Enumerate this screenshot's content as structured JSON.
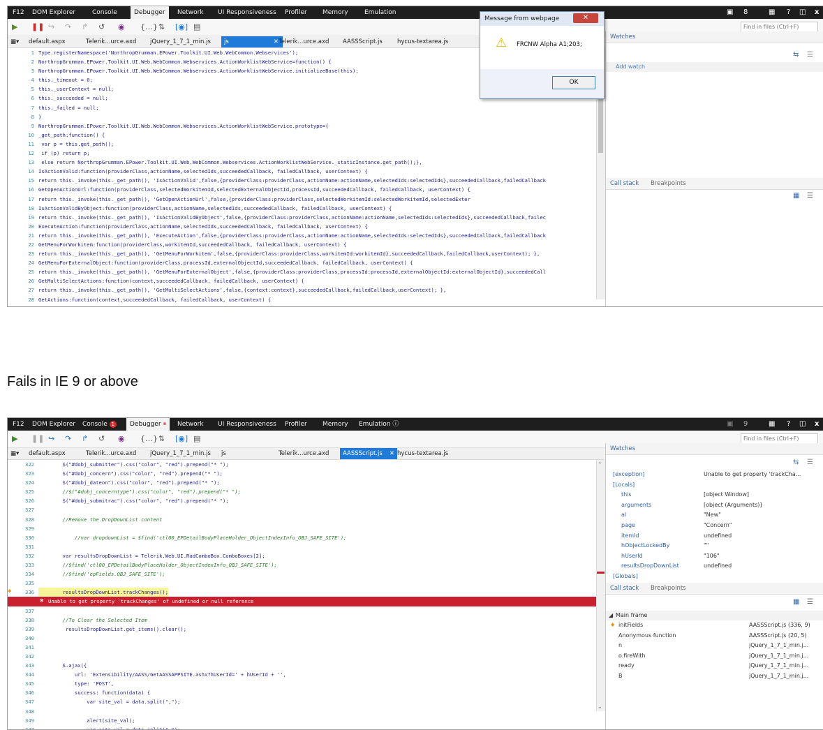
{
  "top_devtools": {
    "tabs": [
      "F12",
      "DOM Explorer",
      "Console",
      "Debugger",
      "Network",
      "UI Responsiveness",
      "Profiler",
      "Memory",
      "Emulation"
    ],
    "active_tab": "Debugger",
    "right_controls": {
      "counter": "8",
      "help": "?",
      "close": "x"
    },
    "find_placeholder": "Find in files (Ctrl+F)",
    "file_tabs": [
      "default.aspx",
      "Telerik...urce.axd",
      "jQuery_1_7_1_min.js",
      "js",
      "Telerik...urce.axd",
      "AASSScript.js",
      "hycus-textarea.js"
    ],
    "active_file": "js",
    "code_lines": [
      {
        "n": "1",
        "t": "Type.registerNamespace('NorthropGrumman.EPower.Toolkit.UI.Web.WebCommon.Webservices');"
      },
      {
        "n": "2",
        "t": "NorthropGrumman.EPower.Toolkit.UI.Web.WebCommon.Webservices.ActionWorklistWebService=function() {"
      },
      {
        "n": "3",
        "t": "NorthropGrumman.EPower.Toolkit.UI.Web.WebCommon.Webservices.ActionWorklistWebService.initializeBase(this);"
      },
      {
        "n": "4",
        "t": "this._timeout = 0;"
      },
      {
        "n": "5",
        "t": "this._userContext = null;"
      },
      {
        "n": "6",
        "t": "this._succeeded = null;"
      },
      {
        "n": "7",
        "t": "this._failed = null;"
      },
      {
        "n": "8",
        "t": "}"
      },
      {
        "n": "9",
        "t": "NorthropGrumman.EPower.Toolkit.UI.Web.WebCommon.Webservices.ActionWorklistWebService.prototype={"
      },
      {
        "n": "10",
        "t": "_get_path:function() {"
      },
      {
        "n": "11",
        "t": " var p = this.get_path();"
      },
      {
        "n": "12",
        "t": " if (p) return p;"
      },
      {
        "n": "13",
        "t": " else return NorthropGrumman.EPower.Toolkit.UI.Web.WebCommon.Webservices.ActionWorklistWebService._staticInstance.get_path();},"
      },
      {
        "n": "14",
        "t": "IsActionValid:function(providerClass,actionName,selectedIds,succeededCallback, failedCallback, userContext) {"
      },
      {
        "n": "15",
        "t": "return this._invoke(this._get_path(), 'IsActionValid',false,{providerClass:providerClass,actionName:actionName,selectedIds:selectedIds},succeededCallback,failedCallback"
      },
      {
        "n": "16",
        "t": "GetOpenActionUrl:function(providerClass,selectedWorkitemId,selectedExternalObjectId,processId,succeededCallback, failedCallback, userContext) {"
      },
      {
        "n": "17",
        "t": "return this._invoke(this._get_path(), 'GetOpenActionUrl',false,{providerClass:providerClass,selectedWorkitemId:selectedWorkitemId,selectedExter"
      },
      {
        "n": "18",
        "t": "IsActionValidByObject:function(providerClass,actionName,selectedIds,succeededCallback, failedCallback, userContext) {"
      },
      {
        "n": "19",
        "t": "return this._invoke(this._get_path(), 'IsActionValidByObject',false,{providerClass:providerClass,actionName:actionName,selectedIds:selectedIds},succeededCallback,failec"
      },
      {
        "n": "20",
        "t": "ExecuteAction:function(providerClass,actionName,selectedIds,succeededCallback, failedCallback, userContext) {"
      },
      {
        "n": "21",
        "t": "return this._invoke(this._get_path(), 'ExecuteAction',false,{providerClass:providerClass,actionName:actionName,selectedIds:selectedIds},succeededCallback,failedCallback"
      },
      {
        "n": "22",
        "t": "GetMenuForWorkitem:function(providerClass,workitemId,succeededCallback, failedCallback, userContext) {"
      },
      {
        "n": "23",
        "t": "return this._invoke(this._get_path(), 'GetMenuForWorkitem',false,{providerClass:providerClass,workitemId:workitemId},succeededCallback,failedCallback,userContext); },"
      },
      {
        "n": "24",
        "t": "GetMenuForExternalObject:function(providerClass,processId,externalObjectId,succeededCallback, failedCallback, userContext) {"
      },
      {
        "n": "25",
        "t": "return this._invoke(this._get_path(), 'GetMenuForExternalObject',false,{providerClass:providerClass,processId:processId,externalObjectId:externalObjectId},succeededCall"
      },
      {
        "n": "26",
        "t": "GetMultiSelectActions:function(context,succeededCallback, failedCallback, userContext) {"
      },
      {
        "n": "27",
        "t": "return this._invoke(this._get_path(), 'GetMultiSelectActions',false,{context:context},succeededCallback,failedCallback,userContext); },"
      },
      {
        "n": "28",
        "t": "GetActions:function(context,succeededCallback, failedCallback, userContext) {"
      }
    ],
    "right_panel": {
      "watches": "Watches",
      "add_watch": "Add watch",
      "call_stack": "Call stack",
      "breakpoints": "Breakpoints"
    },
    "dialog": {
      "title": "Message from webpage",
      "message": "FRCNW Alpha  A1;203;",
      "ok": "OK"
    }
  },
  "caption": "Fails in IE 9 or above",
  "bottom_devtools": {
    "tabs": [
      "F12",
      "DOM Explorer",
      "Console",
      "Debugger",
      "Network",
      "UI Responsiveness",
      "Profiler",
      "Memory",
      "Emulation"
    ],
    "active_tab": "Debugger",
    "console_badge": "1",
    "right_controls": {
      "counter": "9",
      "help": "?",
      "close": "x"
    },
    "find_placeholder": "Find in files (Ctrl+F)",
    "file_tabs": [
      "default.aspx",
      "Telerik...urce.axd",
      "jQuery_1_7_1_min.js",
      "js",
      "Telerik...urce.axd",
      "AASSScript.js",
      "hycus-textarea.js"
    ],
    "active_file": "AASSScript.js",
    "code_lines": [
      {
        "n": "322",
        "t": "        $(\"#dobj_submitter\").css(\"color\", \"red\").prepend(\"* \");"
      },
      {
        "n": "323",
        "t": "        $(\"#dobj_concern\").css(\"color\", \"red\").prepend(\"* \");"
      },
      {
        "n": "324",
        "t": "        $(\"#dobj_dateon\").css(\"color\", \"red\").prepend(\"* \");"
      },
      {
        "n": "325",
        "t": "        //$(\"#dobj_concerntype\").css(\"color\", \"red\").prepend(\"* \");"
      },
      {
        "n": "326",
        "t": "        $(\"#dobj_submitrac\").css(\"color\", \"red\").prepend(\"* \");"
      },
      {
        "n": "327",
        "t": ""
      },
      {
        "n": "328",
        "t": "        //Remove the DropDownList content"
      },
      {
        "n": "329",
        "t": ""
      },
      {
        "n": "330",
        "t": "            //var dropdownList = $find('ctl00_EPDetailBodyPlaceHolder_ObjectIndexInfo_OBJ_SAFE_SITE');"
      },
      {
        "n": "331",
        "t": ""
      },
      {
        "n": "332",
        "t": "        var resultsDropDownList = Telerik.Web.UI.RadComboBox.ComboBoxes[2];"
      },
      {
        "n": "333",
        "t": "        //$find('ctl00_EPDetailBodyPlaceHolder_ObjectIndexInfo_OBJ_SAFE_SITE');"
      },
      {
        "n": "334",
        "t": "        //$find('epFields.OBJ_SAFE_SITE');"
      },
      {
        "n": "335",
        "t": ""
      },
      {
        "n": "336",
        "t": "        resultsDropDownList.trackChanges();"
      },
      {
        "n": "",
        "t": "Unable to get property 'trackChanges' of undefined or null reference"
      },
      {
        "n": "337",
        "t": ""
      },
      {
        "n": "338",
        "t": "        //To Clear the Selected Item"
      },
      {
        "n": "339",
        "t": "         resultsDropDownList.get_items().clear();"
      },
      {
        "n": "340",
        "t": ""
      },
      {
        "n": "341",
        "t": ""
      },
      {
        "n": "342",
        "t": ""
      },
      {
        "n": "343",
        "t": "        $.ajax({"
      },
      {
        "n": "344",
        "t": "            url: 'Extensibility/AASS/GetAASSAPPSITE.ashx?hUserId=' + hUserId + '',"
      },
      {
        "n": "345",
        "t": "            type: 'POST',"
      },
      {
        "n": "346",
        "t": "            success: function(data) {"
      },
      {
        "n": "347",
        "t": "                var site_val = data.split(\",\");"
      },
      {
        "n": "348",
        "t": ""
      },
      {
        "n": "349",
        "t": "                alert(site_val);"
      },
      {
        "n": "347",
        "t": "                var site_val = data.split(\",\");"
      }
    ],
    "highlight_line_index": 14,
    "error_line_index": 15,
    "watches_title": "Watches",
    "watches": [
      {
        "name": "[exception]",
        "value": "Unable to get property 'trackCha..."
      },
      {
        "name": "[Locals]",
        "value": ""
      },
      {
        "name": "this",
        "value": "[object Window]"
      },
      {
        "name": "arguments",
        "value": "[object (Arguments)]"
      },
      {
        "name": "al",
        "value": "\"New\""
      },
      {
        "name": "page",
        "value": "\"Concern\""
      },
      {
        "name": "itemId",
        "value": "undefined"
      },
      {
        "name": "hObjectLockedBy",
        "value": "\"\""
      },
      {
        "name": "hUserId",
        "value": "\"106\""
      },
      {
        "name": "resultsDropDownList",
        "value": "undefined"
      },
      {
        "name": "[Globals]",
        "value": ""
      }
    ],
    "call_stack_title": "Call stack",
    "breakpoints_title": "Breakpoints",
    "main_frame": "Main frame",
    "call_stack": [
      {
        "name": "initFields",
        "value": "AASSScript.js (336, 9)"
      },
      {
        "name": "Anonymous function",
        "value": "AASSScript.js (20, 5)"
      },
      {
        "name": "n",
        "value": "jQuery_1_7_1_min.j..."
      },
      {
        "name": "o.fireWith",
        "value": "jQuery_1_7_1_min.j..."
      },
      {
        "name": "ready",
        "value": "jQuery_1_7_1_min.j..."
      },
      {
        "name": "B",
        "value": "jQuery_1_7_1_min.j..."
      }
    ]
  },
  "colors": {
    "error_bar": "#c8202f",
    "highlight": "#f7f59a",
    "active_file": "#1f7ad8",
    "link": "#2d5fa8"
  }
}
